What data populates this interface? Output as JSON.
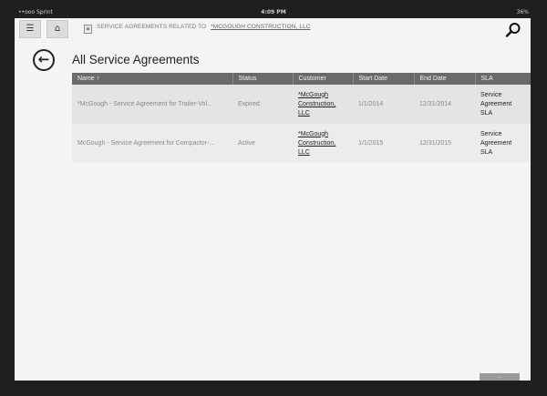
{
  "status_bar": {
    "carrier": "••ooo Sprint",
    "time": "4:09 PM",
    "battery": "36%"
  },
  "topbar": {
    "list_icon": "☰",
    "home_icon": "⌂",
    "breadcrumb_prefix": "SERVICE AGREEMENTS RELATED TO",
    "breadcrumb_link": "*MCGOUGH CONSTRUCTION, LLC"
  },
  "page": {
    "title": "All Service Agreements",
    "back_icon": "←"
  },
  "table": {
    "headers": [
      "Name ↑",
      "Status",
      "Customer",
      "Start Date",
      "End Date",
      "SLA"
    ],
    "rows": [
      {
        "name": "*McGough - Service Agreement for Trailer-Vol...",
        "status": "Expired",
        "customer": "*McGough Construction, LLC",
        "start": "1/1/2014",
        "end": "12/31/2014",
        "sla": "Service Agreement SLA"
      },
      {
        "name": "McGough - Service Agreement for Compactor-...",
        "status": "Active",
        "customer": "*McGough Construction, LLC",
        "start": "1/1/2015",
        "end": "12/31/2015",
        "sla": "Service Agreement SLA"
      }
    ]
  },
  "footer": {
    "more_label": "..."
  },
  "colors": {
    "header_bg": "#6a6a6a",
    "screen_bg": "#f4f4f4",
    "bezel": "#1f1f1f"
  }
}
